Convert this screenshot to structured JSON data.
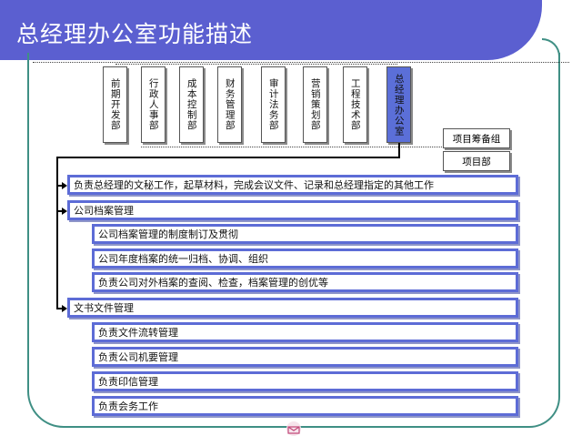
{
  "title": "总经理办公室功能描述",
  "departments": [
    "前期开发部",
    "行政人事部",
    "成本控制部",
    "财务管理部",
    "审计法务部",
    "营销策划部",
    "工程技术部",
    "总经理办公室"
  ],
  "side_boxes": [
    "项目筹备组",
    "项目部"
  ],
  "functions": [
    "负责总经理的文秘工作，起草材料，完成会议文件、记录和总经理指定的其他工作",
    "公司档案管理",
    "公司档案管理的制度制订及贯彻",
    "公司年度档案的统一归档、协调、组织",
    "负责公司对外档案的查阅、检查，档案管理的创优等",
    "文书文件管理",
    "负责文件流转管理",
    "负责公司机要管理",
    "负责印信管理",
    "负责会务工作"
  ],
  "colors": {
    "accent": "#5b5fd0",
    "frame": "#3f8f84"
  },
  "icons": [
    "envelope-logo-icon"
  ]
}
